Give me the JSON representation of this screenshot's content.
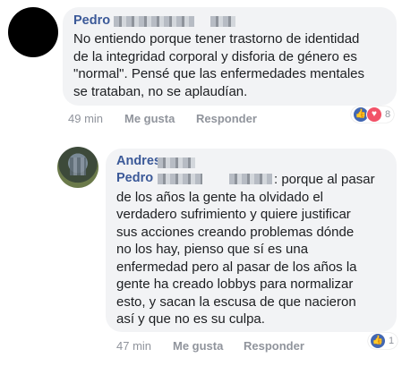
{
  "comment1": {
    "author": "Pedro",
    "lines": [
      "No entiendo porque tener trastorno de identidad",
      "de la integridad corporal y disforia de género es",
      "\"normal\". Pensé que las enfermedades mentales",
      "se trataban, no se aplaudían."
    ],
    "time": "49 min",
    "like_label": "Me gusta",
    "reply_label": "Responder",
    "reactions": {
      "count": "8",
      "icons": [
        "like-icon",
        "love-icon"
      ]
    }
  },
  "comment2": {
    "author": "Andres",
    "mention": "Pedro",
    "first_line_rest": ": porque al pasar",
    "lines": [
      "de los años la gente ha olvidado el",
      "verdadero sufrimiento y quiere justificar",
      "sus acciones creando problemas dónde",
      "no los hay, pienso que sí es una",
      "enfermedad pero al pasar de los años la",
      "gente ha creado lobbys para normalizar",
      "esto, y sacan la escusa de que nacieron",
      "así y que no es su culpa."
    ],
    "time": "47 min",
    "like_label": "Me gusta",
    "reply_label": "Responder",
    "reactions": {
      "count": "1",
      "icons": [
        "like-icon"
      ]
    }
  },
  "colors": {
    "author": "#3b5998",
    "bubble": "#f2f3f5",
    "meta": "#90949c",
    "like": "#4267b2",
    "love": "#f25268"
  }
}
